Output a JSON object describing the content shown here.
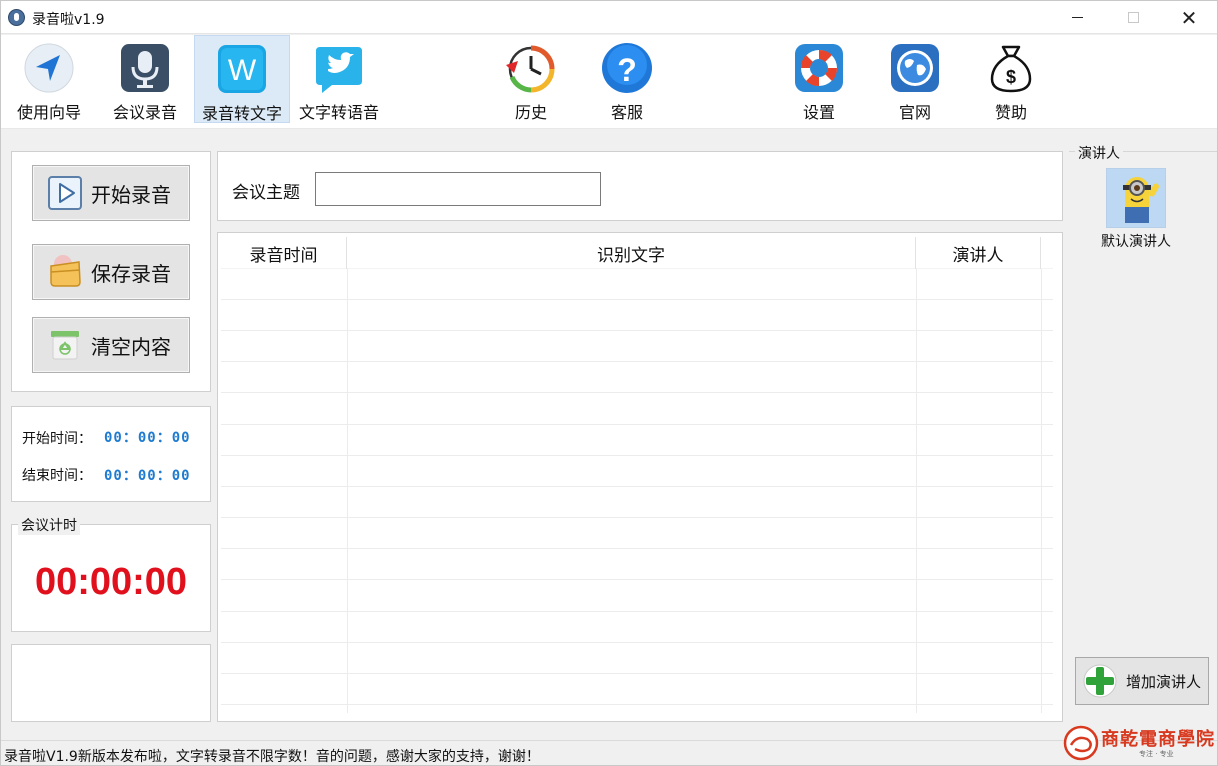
{
  "window": {
    "title": "录音啦v1.9"
  },
  "toolbar": {
    "items": [
      {
        "label": "使用向导",
        "icon": "navigation-arrow-icon"
      },
      {
        "label": "会议录音",
        "icon": "microphone-icon"
      },
      {
        "label": "录音转文字",
        "icon": "word-w-icon",
        "active": true
      },
      {
        "label": "文字转语音",
        "icon": "bird-icon"
      },
      {
        "label": "历史",
        "icon": "history-clock-icon"
      },
      {
        "label": "客服",
        "icon": "help-question-icon"
      },
      {
        "label": "设置",
        "icon": "lifebuoy-icon"
      },
      {
        "label": "官网",
        "icon": "globe-icon"
      },
      {
        "label": "赞助",
        "icon": "money-bag-icon"
      }
    ]
  },
  "controls": {
    "start_label": "开始录音",
    "save_label": "保存录音",
    "clear_label": "清空内容"
  },
  "times": {
    "start_label": "开始时间：",
    "start_value": "00：00：00",
    "end_label": "结束时间：",
    "end_value": "00：00：00"
  },
  "timer": {
    "group_label": "会议计时",
    "value": "00:00:00"
  },
  "topic": {
    "label": "会议主题",
    "value": ""
  },
  "table": {
    "columns": [
      "录音时间",
      "识别文字",
      "演讲人"
    ],
    "rows": []
  },
  "speakers": {
    "group_label": "演讲人",
    "default_name": "默认演讲人",
    "add_label": "增加演讲人"
  },
  "status": {
    "text": "录音啦V1.9新版本发布啦，文字转录音不限字数！音的问题，感谢大家的支持，谢谢！"
  },
  "watermark": {
    "text": "商乾電商學院",
    "sub": "专注 · 专业"
  },
  "colors": {
    "accent_blue": "#1f7bd0",
    "timer_red": "#e0111d",
    "active_tab": "#dceaf7"
  }
}
